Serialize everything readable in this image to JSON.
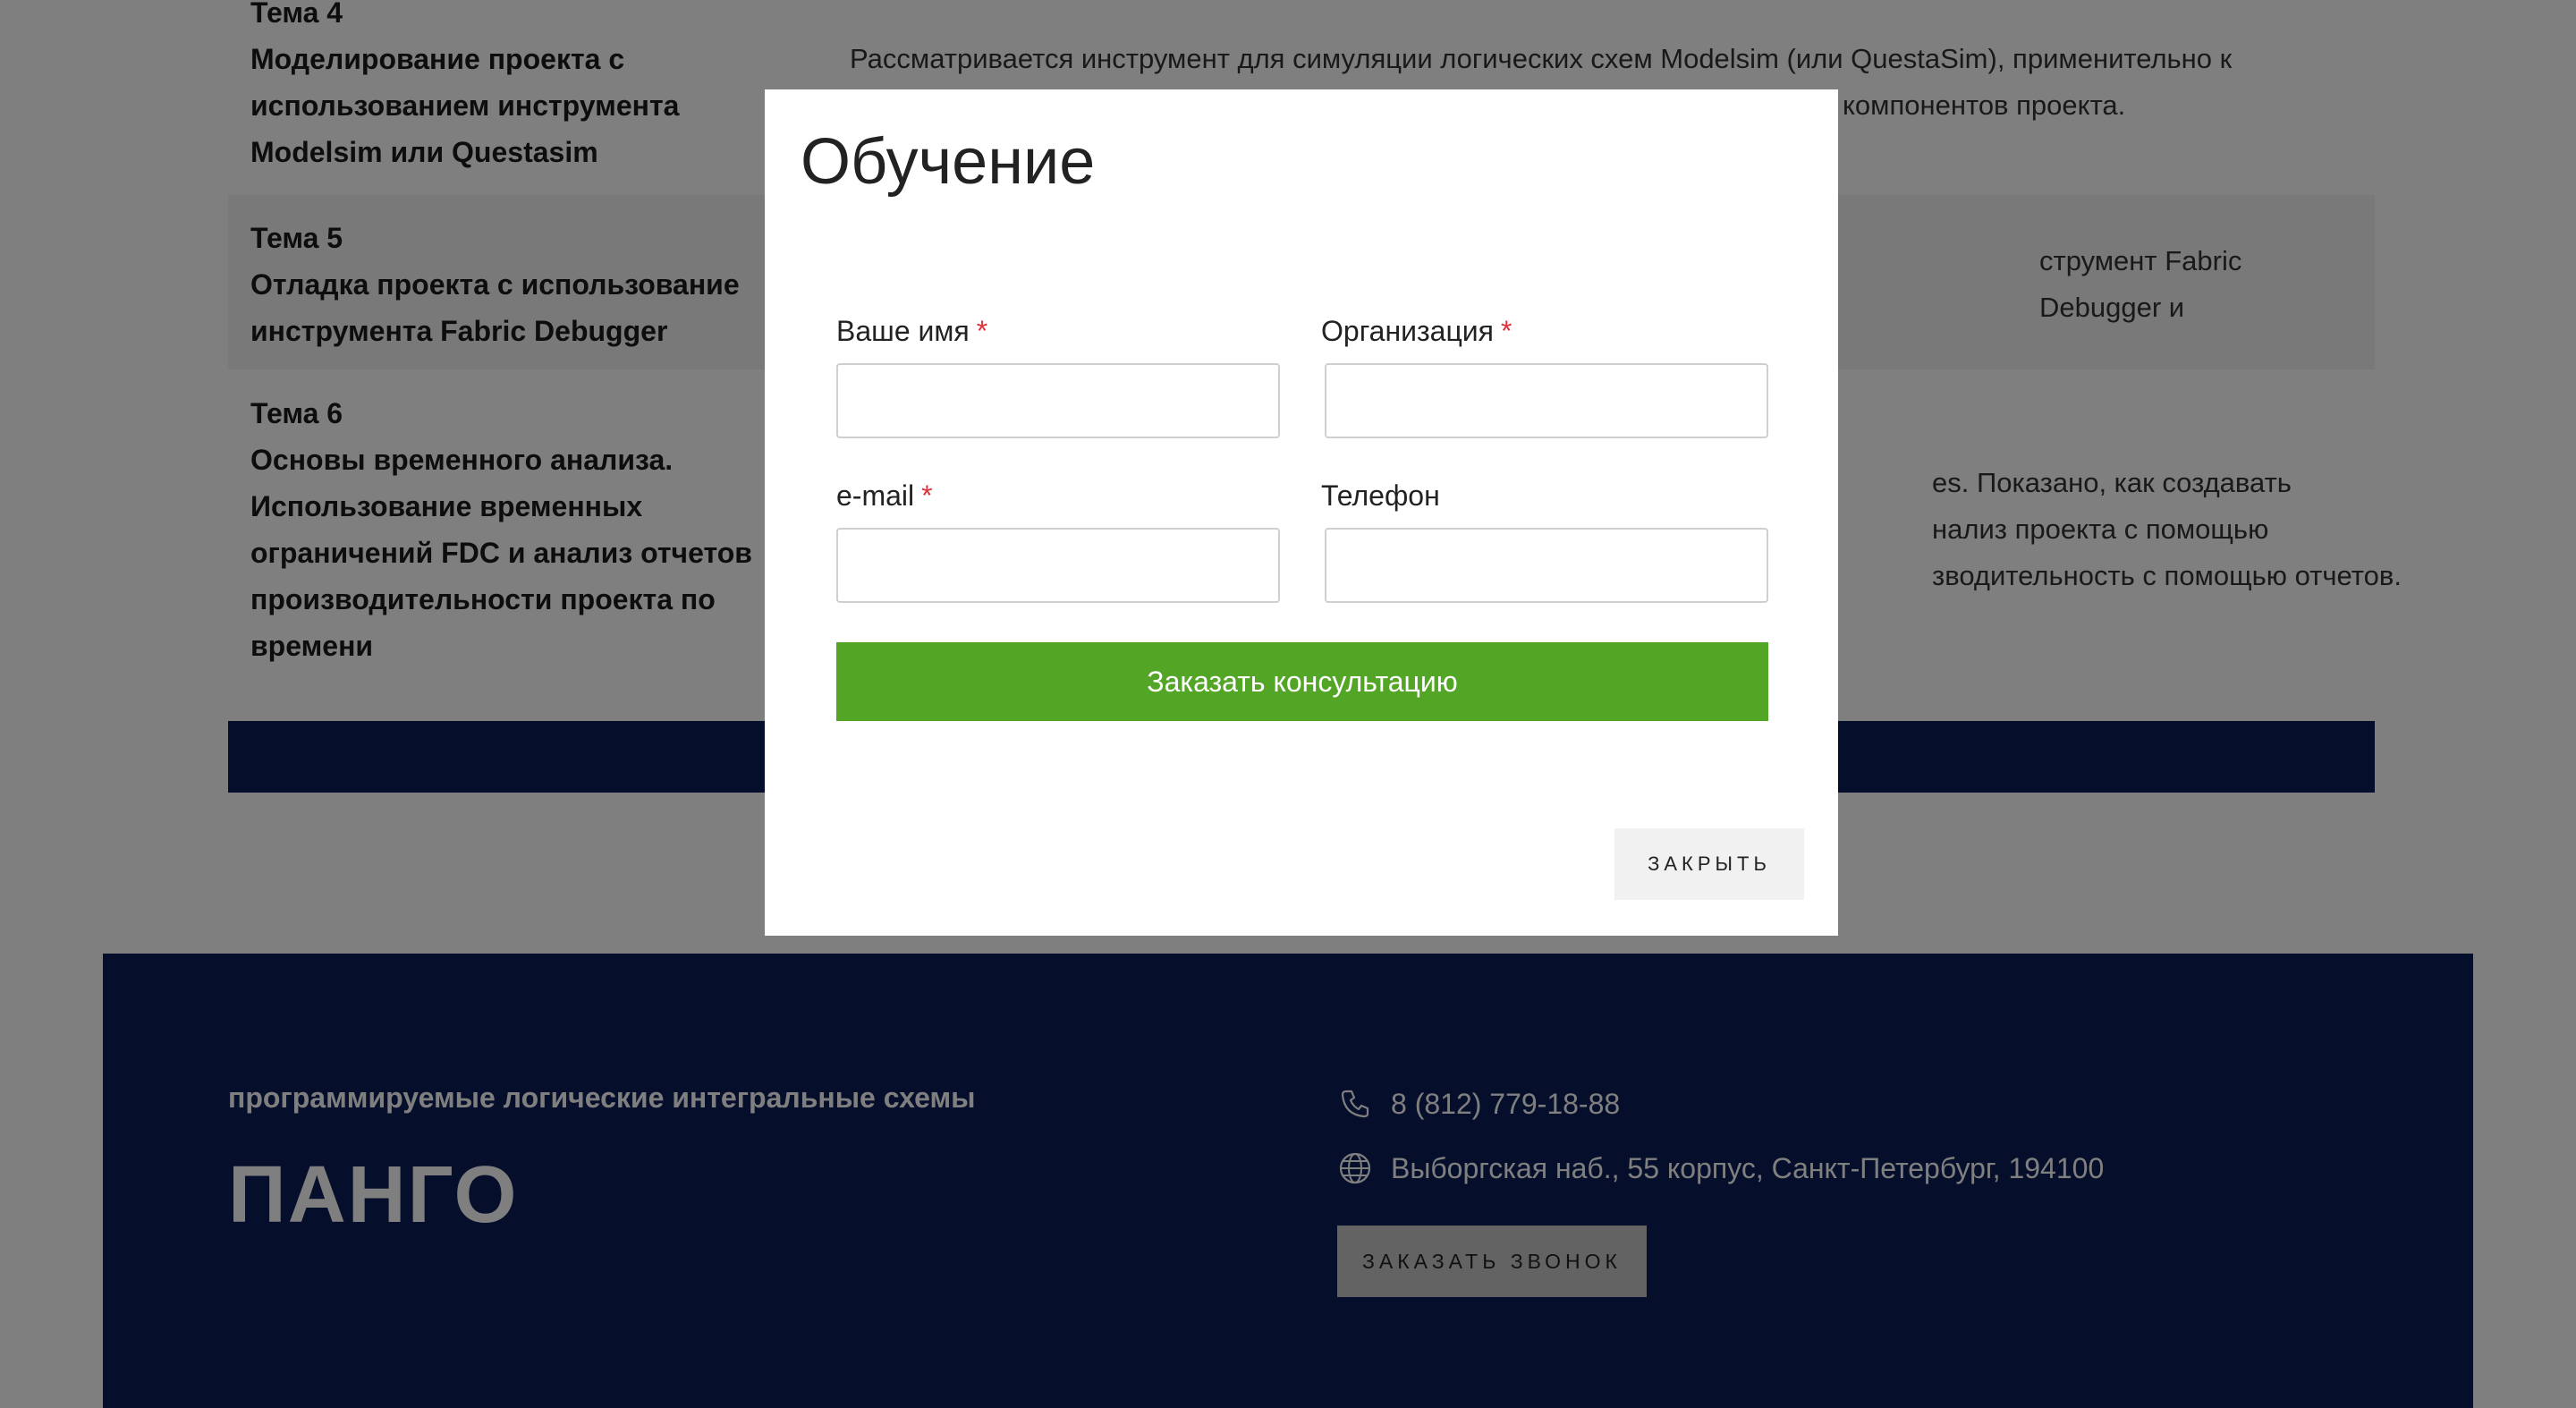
{
  "topics": [
    {
      "heading": "Тема 4",
      "title_lines": [
        "Моделирование проекта с",
        "использованием инструмента",
        "Modelsim или Questasim"
      ],
      "desc_lines": [
        "Рассматривается инструмент для симуляции логических схем Modelsim (или QuestaSim), применительно к",
        "компонентов проекта."
      ]
    },
    {
      "heading": "Тема 5",
      "title_lines": [
        "Отладка проекта с использование",
        "инструмента Fabric Debugger"
      ],
      "desc_lines": [
        "струмент Fabric Debugger и"
      ]
    },
    {
      "heading": "Тема 6",
      "title_lines": [
        "Основы временного анализа.",
        "Использование временных",
        "ограничений FDC и анализ отчетов",
        "производительности проекта по",
        "времени"
      ],
      "desc_lines": [
        "es. Показано, как создавать",
        "нализ проекта с помощью",
        "зводительность с помощью отчетов."
      ]
    }
  ],
  "modal": {
    "title": "Обучение",
    "fields": {
      "name_label": "Ваше имя",
      "org_label": "Организация",
      "email_label": "e-mail",
      "phone_label": "Телефон",
      "required_mark": "*"
    },
    "submit_label": "Заказать консультацию",
    "close_label": "ЗАКРЫТЬ"
  },
  "footer": {
    "tagline": "программируемые логические интегральные схемы",
    "logo_text": "ПАНГО",
    "phone": "8 (812) 779-18-88",
    "address": "Выборгская наб., 55 корпус, Санкт-Петербург, 194100",
    "callback_label": "ЗАКАЗАТЬ ЗВОНОК",
    "phone_icon": "phone-icon",
    "address_icon": "globe-icon"
  },
  "colors": {
    "navy": "#0b1d57",
    "green": "#53a525",
    "required": "#e0313a"
  }
}
